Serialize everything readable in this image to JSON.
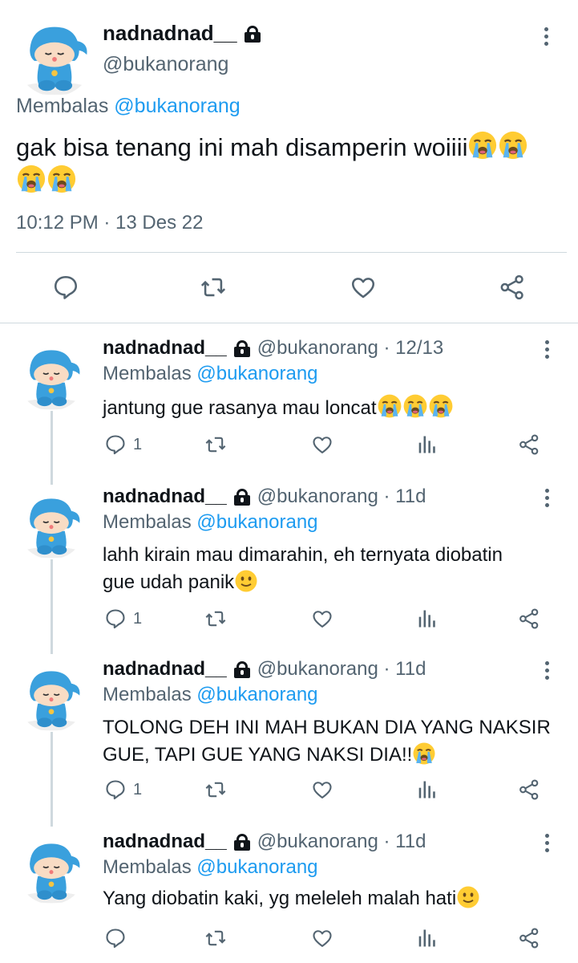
{
  "main_tweet": {
    "display_name": "nadnadnad__",
    "handle": "@bukanorang",
    "replying_prefix": "Membalas",
    "replying_to": "@bukanorang",
    "text": "gak bisa tenang ini mah disamperin woiiii",
    "timestamp": "10:12 PM · 13 Des 22",
    "icons": [
      "lock-icon",
      "more-icon",
      "reply-icon",
      "retweet-icon",
      "like-icon",
      "share-icon"
    ]
  },
  "replies": [
    {
      "display_name": "nadnadnad__",
      "handle": "@bukanorang · 12/13",
      "replying_prefix": "Membalas",
      "replying_to": "@bukanorang",
      "text": "jantung gue rasanya mau loncat",
      "reply_count": "1"
    },
    {
      "display_name": "nadnadnad__",
      "handle": "@bukanorang · 11d",
      "replying_prefix": "Membalas",
      "replying_to": "@bukanorang",
      "text_line1": "lahh kirain mau dimarahin, eh ternyata diobatin",
      "text_line2": "gue udah panik",
      "reply_count": "1"
    },
    {
      "display_name": "nadnadnad__",
      "handle": "@bukanorang · 11d",
      "replying_prefix": "Membalas",
      "replying_to": "@bukanorang",
      "text_line1": "TOLONG DEH INI MAH BUKAN DIA YANG NAKSIR",
      "text_line2": "GUE, TAPI GUE YANG NAKSI DIA!!",
      "reply_count": "1"
    },
    {
      "display_name": "nadnadnad__",
      "handle": "@bukanorang · 11d",
      "replying_prefix": "Membalas",
      "replying_to": "@bukanorang",
      "text": "Yang diobatin kaki, yg meleleh malah hati",
      "reply_count": ""
    }
  ],
  "colors": {
    "text": "#0f1419",
    "muted": "#536471",
    "mention": "#1d9bf0",
    "divider": "#cfd9de",
    "avatar_blue": "#3aa0dd",
    "emoji_yellow": "#ffcc33",
    "tear_blue": "#5ab4f0"
  }
}
